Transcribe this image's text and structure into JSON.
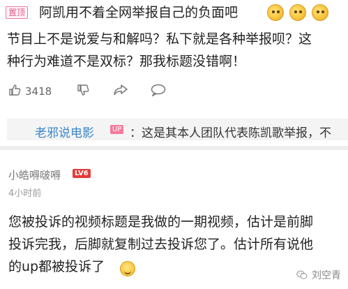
{
  "pinned_comment": {
    "pin_tag": "置顶",
    "line1": "阿凯用不着全网举报自己的负面吧",
    "line2": "节目上不是说爱与和解吗？私下就是各种举报呗？这",
    "line3": "种行为难道不是双标？那我标题没错啊！",
    "emoji_icons": [
      "doge-emoji",
      "doge-emoji",
      "doge-emoji"
    ],
    "like_count": "3418"
  },
  "reply_preview": {
    "author": "老邪说电影",
    "badge": "UP",
    "text": "：这是其本人团队代表陈凯歌举报，不"
  },
  "second_comment": {
    "user_name": "小皓嘚啵嘚",
    "level_badge": "LV6",
    "time": "4小时前",
    "line1": "您被投诉的视频标题是我做的一期视频，估计是前脚",
    "line2": "投诉完我，后脚就复制过去投诉您了。估计所有说他",
    "line3": "的up都被投诉了",
    "trailing_emoji": "laugh-cry-emoji"
  },
  "watermark": {
    "text": "刘空青",
    "icon": "wechat-icon"
  }
}
